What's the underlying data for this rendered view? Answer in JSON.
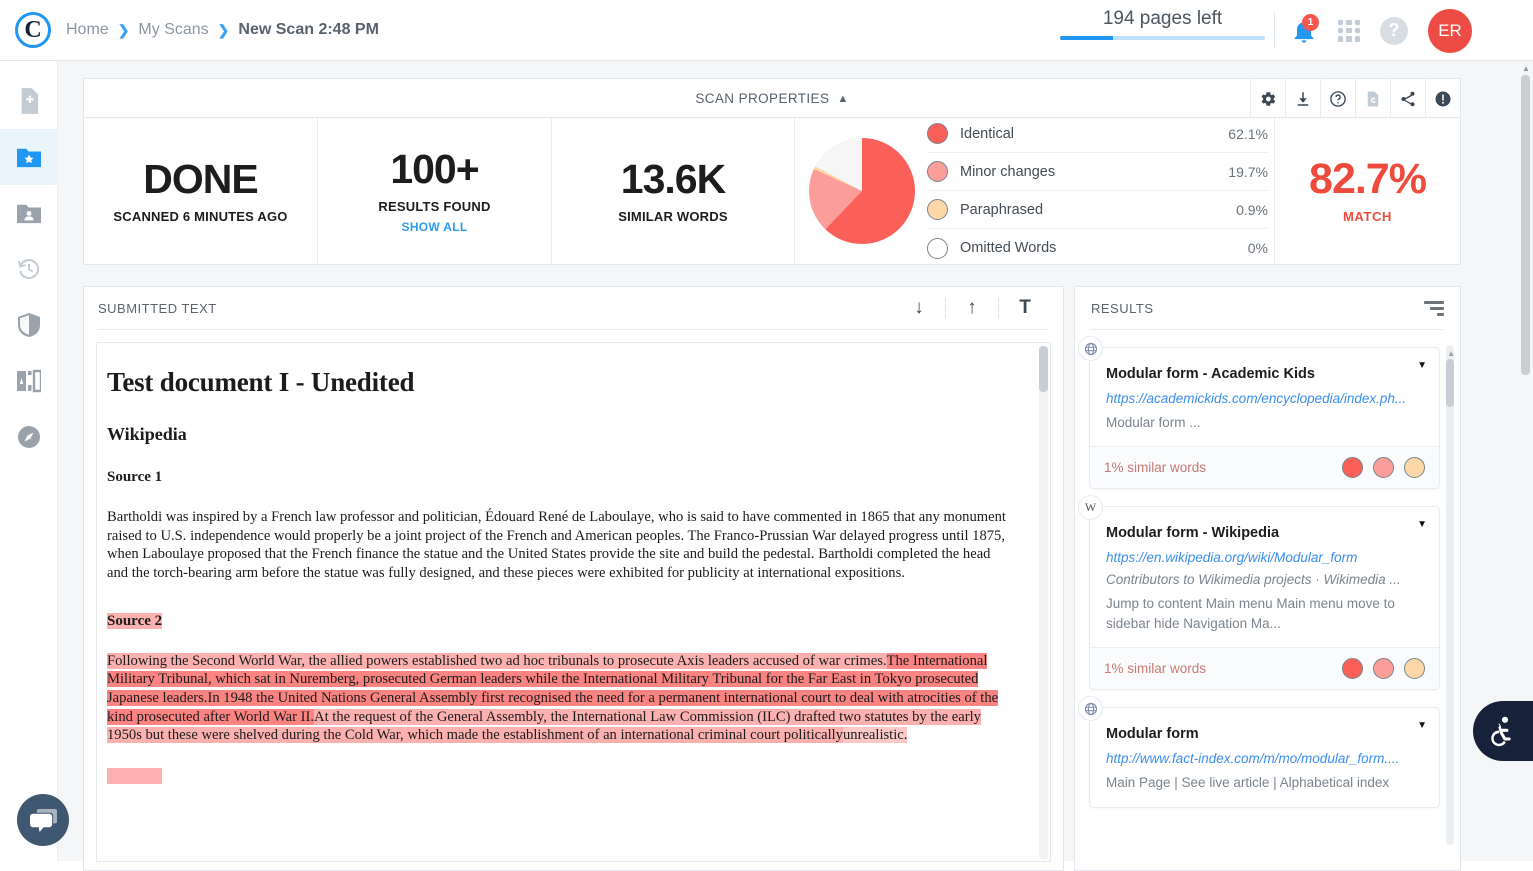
{
  "header": {
    "logo_letter": "C",
    "breadcrumb": [
      {
        "label": "Home",
        "current": false
      },
      {
        "label": "My Scans",
        "current": false
      },
      {
        "label": "New Scan 2:48 PM",
        "current": true
      }
    ],
    "separator": "❯",
    "pages_left": "194 pages left",
    "pages_progress_pct": 26,
    "notification_count": "1",
    "avatar_initials": "ER",
    "help_glyph": "?",
    "icons": [
      "bell-icon",
      "apps-grid-icon",
      "help-icon",
      "avatar"
    ]
  },
  "sidebar": {
    "items": [
      {
        "name": "new-scan",
        "icon": "file-plus-icon",
        "active": false
      },
      {
        "name": "my-scans",
        "icon": "folder-star-icon",
        "active": true
      },
      {
        "name": "shared-folders",
        "icon": "folder-user-icon",
        "active": false
      },
      {
        "name": "history",
        "icon": "history-clock-icon",
        "active": false
      },
      {
        "name": "protection",
        "icon": "shield-icon",
        "active": false
      },
      {
        "name": "compare",
        "icon": "compare-pages-icon",
        "active": false
      },
      {
        "name": "explore",
        "icon": "compass-icon",
        "active": false
      }
    ]
  },
  "scan_properties": {
    "title": "SCAN PROPERTIES",
    "collapse_glyph": "︿",
    "tools": [
      {
        "name": "settings-gear-icon",
        "disabled": false
      },
      {
        "name": "download-icon",
        "disabled": false
      },
      {
        "name": "help-icon",
        "disabled": false
      },
      {
        "name": "restore-document-icon",
        "disabled": true
      },
      {
        "name": "share-icon",
        "disabled": false
      },
      {
        "name": "alert-icon",
        "disabled": false
      }
    ],
    "status": {
      "value": "DONE",
      "caption": "SCANNED 6 MINUTES AGO"
    },
    "results": {
      "value": "100+",
      "caption": "RESULTS FOUND",
      "link": "SHOW ALL"
    },
    "similar_words": {
      "value": "13.6K",
      "caption": "SIMILAR WORDS"
    },
    "match": {
      "value": "82.7%",
      "caption": "MATCH",
      "color": "#ef4b3c"
    }
  },
  "chart_data": {
    "type": "pie",
    "title": "Similarity breakdown",
    "categories": [
      "Identical",
      "Minor changes",
      "Paraphrased",
      "Omitted Words"
    ],
    "values": [
      62.1,
      19.7,
      0.9,
      0
    ],
    "labels": [
      "62.1%",
      "19.7%",
      "0.9%",
      "0%"
    ],
    "colors": [
      "#fb5f59",
      "#fb9e9a",
      "#fcd8a8",
      "#ffffff"
    ],
    "remainder_color": "#f6f6f6",
    "legend": "right",
    "total_match": 82.7
  },
  "submitted_text": {
    "title": "SUBMITTED TEXT",
    "tools": [
      {
        "name": "scroll-down-icon",
        "glyph": "↓"
      },
      {
        "name": "scroll-up-icon",
        "glyph": "↑"
      },
      {
        "name": "text-format-icon",
        "glyph": "T"
      }
    ],
    "document": {
      "title": "Test document I - Unedited",
      "subtitle": "Wikipedia",
      "source1_heading": "Source 1",
      "source1_paragraph": "Bartholdi was inspired by a French law professor and politician, Édouard René de Laboulaye, who is said to have commented in 1865 that any monument raised to U.S. independence would properly be a joint project of the French and American peoples. The Franco-Prussian War delayed progress until 1875, when Laboulaye proposed that the French finance the statue and the United States provide the site and build the pedestal. Bartholdi completed the head and the torch-bearing arm before the statue was fully designed, and these pieces were exhibited for publicity at international expositions.",
      "source2_heading": "Source 2",
      "source2_seg1": "Following the Second World War, the allied powers established two ad hoc tribunals to prosecute Axis leaders accused of war crimes.",
      "source2_seg2": "The International Military Tribunal, which sat in Nuremberg, prosecuted German leaders while the International Military Tribunal for the Far East in Tokyo prosecuted Japanese leaders.",
      "source2_seg3": "In 1948 the United Nations General Assembly first recognised the need for a permanent international court to deal with atrocities of the kind prosecuted after World War II.",
      "source2_seg4": "At the request of the General Assembly, the International Law Commission (ILC) drafted two statutes by the early 1950s but these were shelved during the Cold War, which made the establishment of an international criminal court politically",
      "source2_seg5": "unrealistic."
    }
  },
  "results": {
    "title": "RESULTS",
    "filter_icon": "filter-icon",
    "cards": [
      {
        "favicon": "globe-icon",
        "favicon_glyph": "🌐",
        "name": "Modular form - Academic Kids",
        "url": "https://academickids.com/encyclopedia/index.ph...",
        "meta": "",
        "snippet": "Modular form ...",
        "similar": "1% similar words",
        "dots": [
          "#fb5f59",
          "#fb9e9a",
          "#fcd8a8"
        ]
      },
      {
        "favicon": "wikipedia-icon",
        "favicon_glyph": "W",
        "name": "Modular form - Wikipedia",
        "url": "https://en.wikipedia.org/wiki/Modular_form",
        "meta": "Contributors to Wikimedia projects  ·  Wikimedia ...",
        "snippet": "Jump to content Main menu Main menu move to sidebar hide Navigation Ma...",
        "similar": "1% similar words",
        "dots": [
          "#fb5f59",
          "#fb9e9a",
          "#fcd8a8"
        ]
      },
      {
        "favicon": "globe-icon",
        "favicon_glyph": "🌐",
        "name": "Modular form",
        "url": "http://www.fact-index.com/m/mo/modular_form....",
        "meta": "",
        "snippet": "Main Page | See live article | Alphabetical index",
        "similar": "",
        "dots": []
      }
    ]
  },
  "floating": {
    "chat_icon": "chat-bubble-icon",
    "accessibility_icon": "accessibility-wheelchair-icon"
  }
}
